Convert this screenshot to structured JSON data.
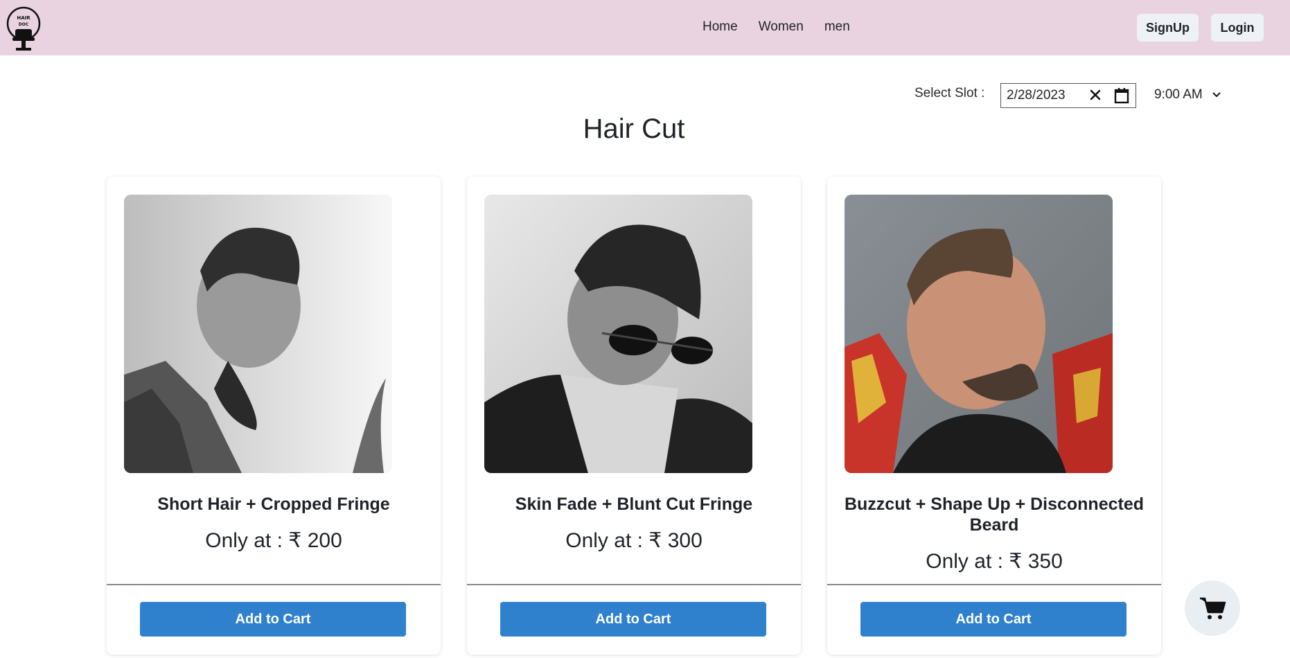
{
  "header": {
    "logo_alt": "HAIR DOC",
    "nav": [
      {
        "label": "Home"
      },
      {
        "label": "Women"
      },
      {
        "label": "men"
      }
    ],
    "signup_label": "SignUp",
    "login_label": "Login"
  },
  "slot": {
    "label": "Select Slot :",
    "date_value": "2/28/2023",
    "time_value": "9:00 AM"
  },
  "page_title": "Hair Cut",
  "cards": [
    {
      "title": "Short Hair + Cropped Fringe",
      "price": "Only at : ₹ 200",
      "button": "Add to Cart",
      "image": "portrait-bw-beard"
    },
    {
      "title": "Skin Fade + Blunt Cut Fringe",
      "price": "Only at : ₹ 300",
      "button": "Add to Cart",
      "image": "portrait-bw-sunglasses"
    },
    {
      "title": "Buzzcut + Shape Up + Disconnected Beard",
      "price": "Only at : ₹ 350",
      "button": "Add to Cart",
      "image": "portrait-color-buzzcut"
    }
  ],
  "icons": {
    "logo": "barber-chair-logo",
    "date_clear": "close-icon",
    "date_calendar": "calendar-icon",
    "time_dropdown": "chevron-down-icon",
    "floating_cart": "shopping-cart-icon"
  },
  "colors": {
    "navbar_bg": "#ead3e0",
    "primary_button": "#2f81cd",
    "auth_button_bg": "#eef1f6",
    "floating_cart_bg": "#e9eef3"
  }
}
